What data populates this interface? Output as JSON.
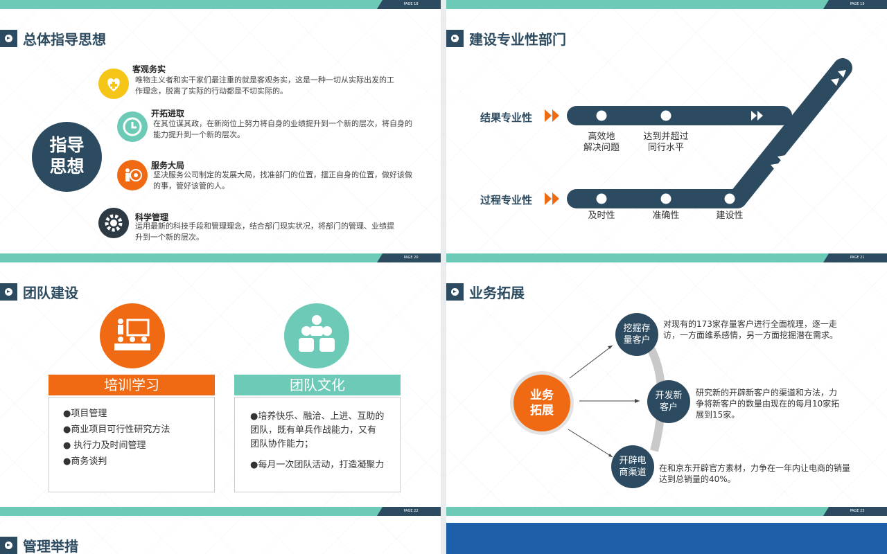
{
  "slides": [
    {
      "page": "PAGE 18",
      "title": "总体指导思想",
      "center": "指导\n思想",
      "items": [
        {
          "title": "客观务实",
          "desc": "唯物主义者和实干家们最注重的就是客观务实，这是一种一切从实际出发的工作理念，脱离了实际的行动都是不切实际的。",
          "icon": "heart-plus-icon",
          "color": "#f5c518"
        },
        {
          "title": "开拓进取",
          "desc": "在其位谋其政，在新岗位上努力将自身的业绩提升到一个新的层次，将自身的能力提升到一个新的层次。",
          "icon": "clock-icon",
          "color": "#6ccab6"
        },
        {
          "title": "服务大局",
          "desc": "坚决服务公司制定的发展大局，找准部门的位置，摆正自身的位置，做好该做的事，管好该管的人。",
          "icon": "target-person-icon",
          "color": "#ef6a12"
        },
        {
          "title": "科学管理",
          "desc": "运用最新的科技手段和管理理念，结合部门现实状况，将部门的管理、业绩提升到一个新的层次。",
          "icon": "gear-icon",
          "color": "#2d3a44"
        }
      ]
    },
    {
      "page": "PAGE 19",
      "title": "建设专业性部门",
      "row1_label": "结果专业性",
      "row2_label": "过程专业性",
      "row1_points": [
        "高效地\n解决问题",
        "达到并超过\n同行水平"
      ],
      "row2_points": [
        "及时性",
        "准确性",
        "建设性"
      ]
    },
    {
      "page": "PAGE 20",
      "title": "团队建设",
      "left": {
        "heading": "培训学习",
        "items": [
          "●项目管理",
          "●商业项目可行性研究方法",
          "● 执行力及时间管理",
          "●商务谈判"
        ],
        "color": "#ef6a12"
      },
      "right": {
        "heading": "团队文化",
        "items": [
          "●培养快乐、融洽、上进、互助的团队，既有单兵作战能力，又有团队协作能力；",
          "●每月一次团队活动，打造凝聚力"
        ],
        "color": "#6ccab6"
      }
    },
    {
      "page": "PAGE 21",
      "title": "业务拓展",
      "center": "业务\n拓展",
      "nodes": [
        {
          "label": "挖掘存\n量客户",
          "desc": "对现有的173家存量客户进行全面梳理，逐一走访，一方面维系感情，另一方面挖掘潜在需求。"
        },
        {
          "label": "开发新\n客户",
          "desc": "研究新的开辟新客户的渠道和方法，力争将新客户的数量由现在的每月10家拓展到15家。"
        },
        {
          "label": "开辟电\n商渠道",
          "desc": "在和京东开辟官方素材，力争在一年内让电商的销量达到总销量的40%。"
        }
      ]
    },
    {
      "page": "PAGE 22",
      "title": "管理举措"
    },
    {
      "page": "PAGE 23"
    }
  ]
}
